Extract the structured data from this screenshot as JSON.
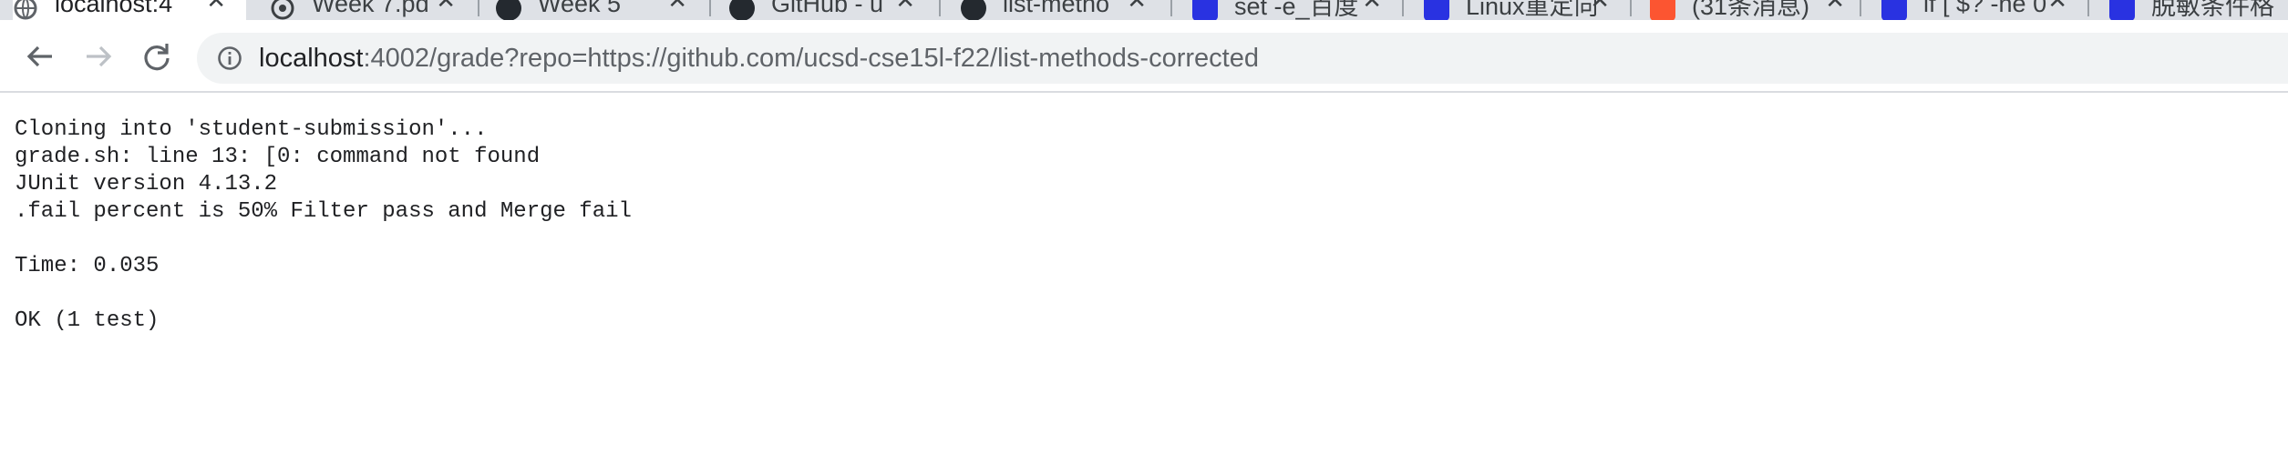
{
  "browser": {
    "tabs": [
      {
        "title": "localhost:4",
        "favicon": "globe-icon",
        "active": true
      },
      {
        "title": "Week 7.pd",
        "favicon": "chrome-icon",
        "active": false
      },
      {
        "title": "Week 5",
        "favicon": "dark-circle-icon",
        "active": false
      },
      {
        "title": "GitHub - u",
        "favicon": "github-icon",
        "active": false
      },
      {
        "title": "list-metho",
        "favicon": "github-icon",
        "active": false
      },
      {
        "title": "set -e_百度",
        "favicon": "baidu-icon",
        "active": false
      },
      {
        "title": "Linux重定向",
        "favicon": "baidu-icon",
        "active": false
      },
      {
        "title": "(31条消息)",
        "favicon": "csdn-icon",
        "active": false
      },
      {
        "title": "if [ $? -ne 0",
        "favicon": "baidu-icon",
        "active": false
      },
      {
        "title": "脱敏条件格",
        "favicon": "baidu-icon",
        "active": false
      }
    ],
    "url_host": "localhost",
    "url_rest": ":4002/grade?repo=https://github.com/ucsd-cse15l-f22/list-methods-corrected"
  },
  "page": {
    "output": "Cloning into 'student-submission'...\ngrade.sh: line 13: [0: command not found\nJUnit version 4.13.2\n.fail percent is 50% Filter pass and Merge fail\n\nTime: 0.035\n\nOK (1 test)"
  },
  "colors": {
    "tabstrip": "#dee1e6",
    "omnibox": "#f1f3f4",
    "csdn": "#fc5531",
    "baidu": "#2932e1"
  }
}
